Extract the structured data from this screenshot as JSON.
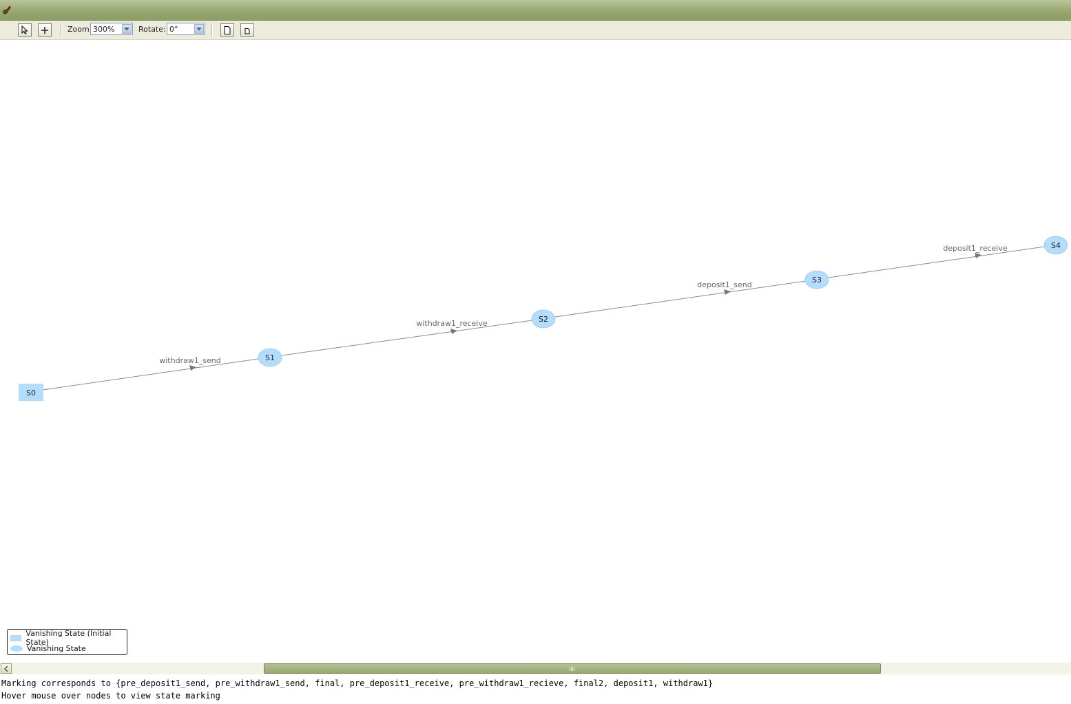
{
  "toolbar": {
    "zoom_label": "Zoom:",
    "zoom_value": "300%",
    "rotate_label": "Rotate:",
    "rotate_value": "0°",
    "buttons": [
      {
        "icon": "pointer-icon"
      },
      {
        "icon": "plus-icon"
      },
      {
        "icon": "page-icon"
      },
      {
        "icon": "small-page-icon"
      }
    ]
  },
  "graph": {
    "states": [
      "S0",
      "S1",
      "S2",
      "S3",
      "S4"
    ],
    "transitions": [
      "withdraw1_send",
      "withdraw1_receive",
      "deposit1_send",
      "deposit1_receive"
    ],
    "colors": {
      "node": "#b4dcfc",
      "edge": "#8a8a8a",
      "label": "#666666"
    }
  },
  "legend": {
    "initial_label": "Vanishing State (Initial State)",
    "state_label": "Vanishing State"
  },
  "status": {
    "marking": "Marking corresponds to {pre_deposit1_send, pre_withdraw1_send, final, pre_deposit1_receive, pre_withdraw1_recieve, final2, deposit1, withdraw1}",
    "hint": "Hover mouse over nodes to view state marking"
  }
}
